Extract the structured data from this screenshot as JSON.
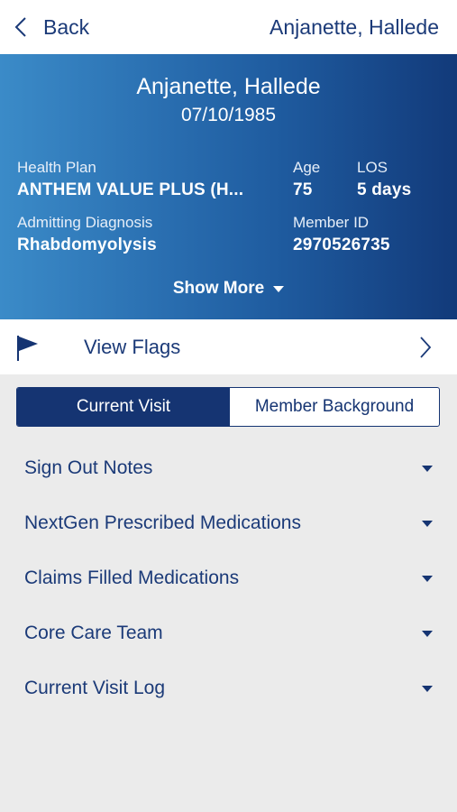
{
  "nav": {
    "back_label": "Back",
    "title": "Anjanette, Hallede"
  },
  "patient": {
    "name": "Anjanette, Hallede",
    "dob": "07/10/1985",
    "health_plan_label": "Health Plan",
    "health_plan": "ANTHEM VALUE PLUS (H...",
    "age_label": "Age",
    "age": "75",
    "los_label": "LOS",
    "los": "5 days",
    "diagnosis_label": "Admitting Diagnosis",
    "diagnosis": "Rhabdomyolysis",
    "member_id_label": "Member ID",
    "member_id": "2970526735",
    "show_more_label": "Show More"
  },
  "flags": {
    "label": "View Flags"
  },
  "tabs": [
    {
      "label": "Current Visit",
      "active": true
    },
    {
      "label": "Member Background",
      "active": false
    }
  ],
  "sections": [
    {
      "label": "Sign Out Notes"
    },
    {
      "label": "NextGen Prescribed Medications"
    },
    {
      "label": "Claims Filled Medications"
    },
    {
      "label": "Core Care Team"
    },
    {
      "label": "Current Visit Log"
    }
  ],
  "colors": {
    "primary": "#153472",
    "text": "#1b3a78",
    "background": "#ebebeb"
  }
}
